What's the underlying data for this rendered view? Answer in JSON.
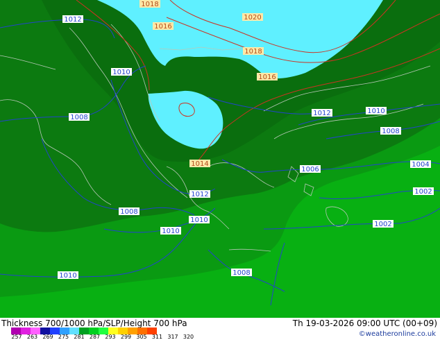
{
  "map": {
    "isobar_labels": [
      "1018",
      "1020",
      "1012",
      "1016",
      "1018",
      "1016",
      "1010",
      "1008",
      "1012",
      "1010",
      "1008",
      "1014",
      "1006",
      "1004",
      "1012",
      "1002",
      "1008",
      "1010",
      "1002",
      "1010",
      "1010",
      "1008"
    ],
    "red_labels": [
      "1018",
      "1016",
      "1018",
      "1016",
      "1014"
    ],
    "colors": {
      "thickness_cyan": "#5ff0ff",
      "thickness_dark_green": "#0c7a10",
      "thickness_mid_green": "#0a9a12",
      "thickness_light_green": "#08b012",
      "isobar_blue": "#2244cc",
      "height_red": "#cc3322",
      "coast": "#b8c8b8"
    }
  },
  "footer": {
    "title": "Thickness 700/1000 hPa/SLP/Height 700 hPa",
    "datetime": "Th 19-03-2026 09:00 UTC (00+09)",
    "credit": "©weatheronline.co.uk",
    "legend_ticks": [
      "257",
      "263",
      "269",
      "275",
      "281",
      "287",
      "293",
      "299",
      "305",
      "311",
      "317",
      "320"
    ],
    "legend_colors": [
      "#b000b0",
      "#e020e0",
      "#ff60ff",
      "#1010a0",
      "#2040ff",
      "#2fa0ff",
      "#60e0ff",
      "#00a020",
      "#00d020",
      "#20ff40",
      "#ffff20",
      "#ffd000",
      "#ffa000",
      "#ff7000",
      "#ff4000"
    ]
  }
}
